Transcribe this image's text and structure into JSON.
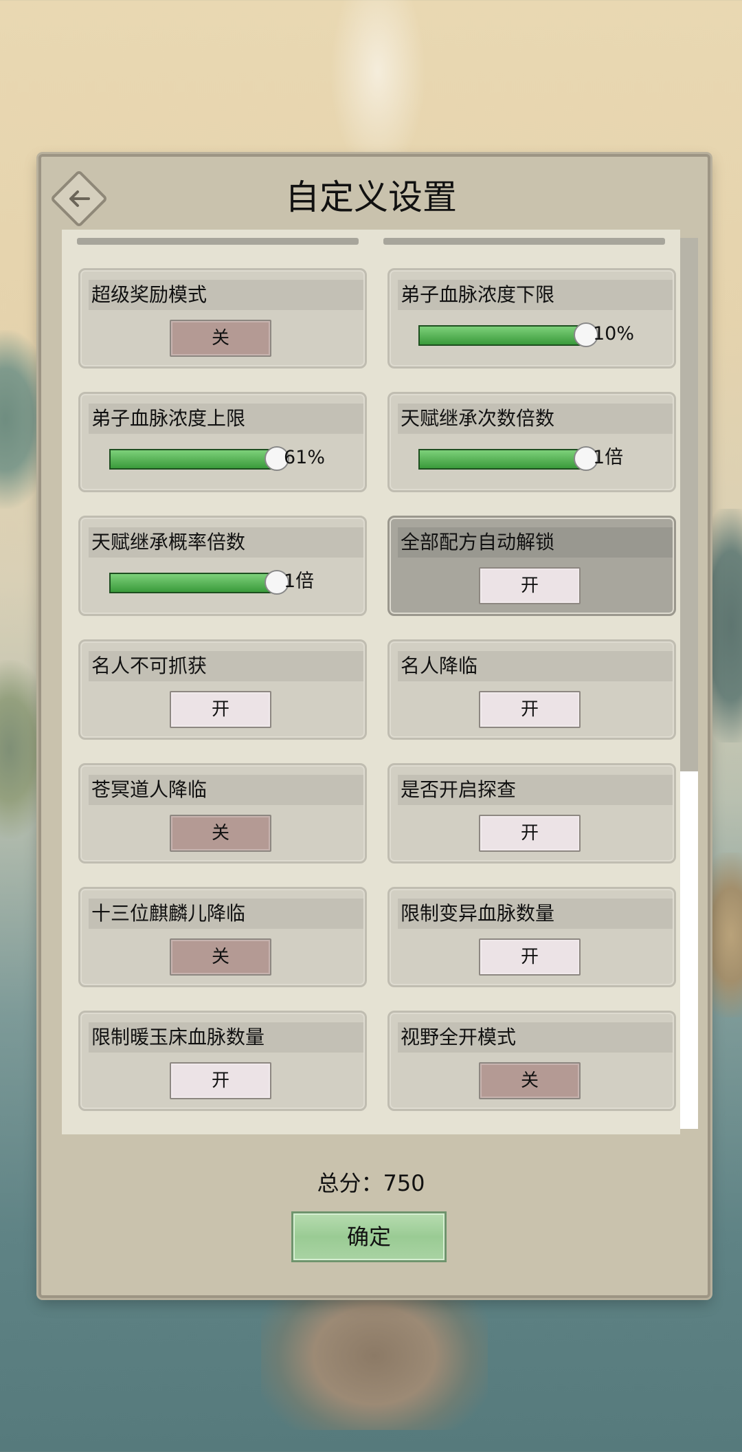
{
  "title": "自定义设置",
  "settings": [
    {
      "label": "超级奖励模式",
      "type": "toggle",
      "value": "关",
      "state": "off"
    },
    {
      "label": "弟子血脉浓度下限",
      "type": "slider",
      "value": "10%",
      "level": 1.0
    },
    {
      "label": "弟子血脉浓度上限",
      "type": "slider",
      "value": "61%",
      "level": 1.0
    },
    {
      "label": "天赋继承次数倍数",
      "type": "slider",
      "value": "1倍",
      "level": 1.0
    },
    {
      "label": "天赋继承概率倍数",
      "type": "slider",
      "value": "1倍",
      "level": 1.0
    },
    {
      "label": "全部配方自动解锁",
      "type": "toggle",
      "value": "开",
      "state": "on",
      "highlighted": true
    },
    {
      "label": "名人不可抓获",
      "type": "toggle",
      "value": "开",
      "state": "on"
    },
    {
      "label": "名人降临",
      "type": "toggle",
      "value": "开",
      "state": "on"
    },
    {
      "label": "苍冥道人降临",
      "type": "toggle",
      "value": "关",
      "state": "off"
    },
    {
      "label": "是否开启探查",
      "type": "toggle",
      "value": "开",
      "state": "on"
    },
    {
      "label": "十三位麒麟儿降临",
      "type": "toggle",
      "value": "关",
      "state": "off"
    },
    {
      "label": "限制变异血脉数量",
      "type": "toggle",
      "value": "开",
      "state": "on"
    },
    {
      "label": "限制暖玉床血脉数量",
      "type": "toggle",
      "value": "开",
      "state": "on"
    },
    {
      "label": "视野全开模式",
      "type": "toggle",
      "value": "关",
      "state": "off"
    }
  ],
  "footer": {
    "score_text": "总分：750",
    "confirm_label": "确定"
  },
  "icons": {
    "back": "back-arrow-icon"
  },
  "colors": {
    "slider_fill": "#3a9b3b",
    "toggle_off": "#b49a94",
    "toggle_on": "#ece3e6"
  }
}
